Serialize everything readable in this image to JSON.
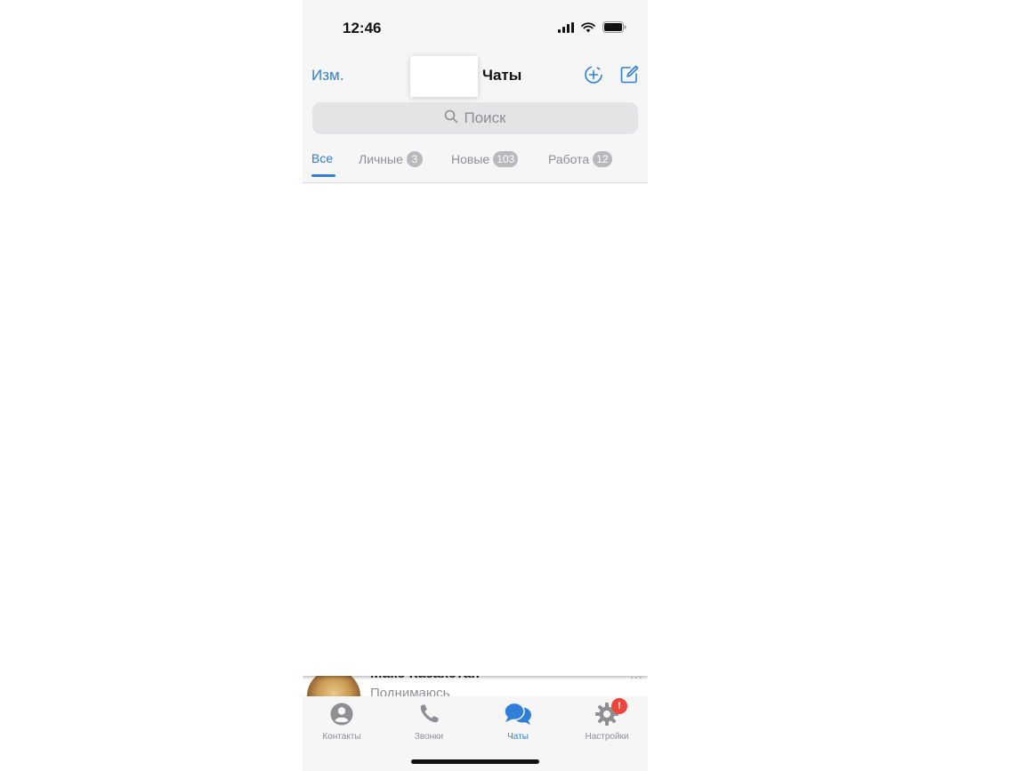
{
  "status_bar": {
    "time": "12:46",
    "icons": [
      "cellular-signal-icon",
      "wifi-icon",
      "battery-icon"
    ]
  },
  "nav": {
    "edit_label": "Изм.",
    "title": "Чаты",
    "actions": [
      "add-circle-icon",
      "compose-icon"
    ]
  },
  "search": {
    "placeholder": "Поиск"
  },
  "tabs": [
    {
      "label": "Все",
      "badge": null,
      "active": true
    },
    {
      "label": "Личные",
      "badge": "3",
      "active": false
    },
    {
      "label": "Новые",
      "badge": "103",
      "active": false
    },
    {
      "label": "Работа",
      "badge": "12",
      "active": false
    }
  ],
  "chat_peek": {
    "name": "Макс Казахстан",
    "preview": "Поднимаюсь",
    "more": "···"
  },
  "tab_bar": {
    "items": [
      {
        "label": "Контакты",
        "icon": "person-circle-icon",
        "active": false
      },
      {
        "label": "Звонки",
        "icon": "phone-icon",
        "active": false
      },
      {
        "label": "Чаты",
        "icon": "chat-bubbles-icon",
        "active": true
      },
      {
        "label": "Настройки",
        "icon": "gear-icon",
        "active": false,
        "badge": "!"
      }
    ]
  },
  "colors": {
    "accent": "#2f7fd8",
    "muted": "#8e8e93",
    "badge_bg": "#b9b9bd",
    "alert": "#f0433a"
  }
}
